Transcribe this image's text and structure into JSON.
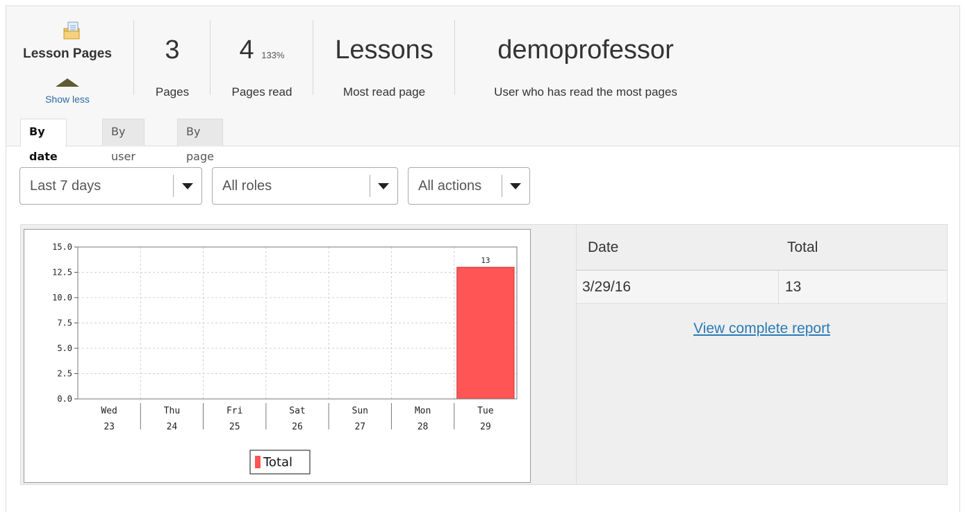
{
  "tool": {
    "name": "Lesson Pages",
    "toggle_label": "Show less",
    "icon": "lesson-pages-icon"
  },
  "stats": {
    "pages": {
      "value": "3",
      "label": "Pages"
    },
    "pages_read": {
      "value": "4",
      "percent": "133%",
      "label": "Pages read"
    },
    "most_read": {
      "value": "Lessons",
      "label": "Most read page"
    },
    "top_user": {
      "value": "demoprofessor",
      "label": "User who has read the most pages"
    }
  },
  "tabs": [
    {
      "label": "By date",
      "active": true
    },
    {
      "label": "By user",
      "active": false
    },
    {
      "label": "By page",
      "active": false
    }
  ],
  "filters": {
    "period": "Last 7 days",
    "roles": "All roles",
    "actions": "All actions"
  },
  "table": {
    "headers": [
      "Date",
      "Total"
    ],
    "rows": [
      {
        "date": "3/29/16",
        "total": "13"
      }
    ],
    "link_label": "View complete report"
  },
  "chart_data": {
    "type": "bar",
    "categories": [
      [
        "Wed",
        "23"
      ],
      [
        "Thu",
        "24"
      ],
      [
        "Fri",
        "25"
      ],
      [
        "Sat",
        "26"
      ],
      [
        "Sun",
        "27"
      ],
      [
        "Mon",
        "28"
      ],
      [
        "Tue",
        "29"
      ]
    ],
    "series": [
      {
        "name": "Total",
        "values": [
          0,
          0,
          0,
          0,
          0,
          0,
          13
        ],
        "color": "#ff5555"
      }
    ],
    "data_labels": [
      "",
      "",
      "",
      "",
      "",
      "",
      "13"
    ],
    "yticks": [
      "0.0",
      "2.5",
      "5.0",
      "7.5",
      "10.0",
      "12.5",
      "15.0"
    ],
    "ylim": [
      0,
      15
    ],
    "grid": true,
    "legend": "bottom-center"
  }
}
